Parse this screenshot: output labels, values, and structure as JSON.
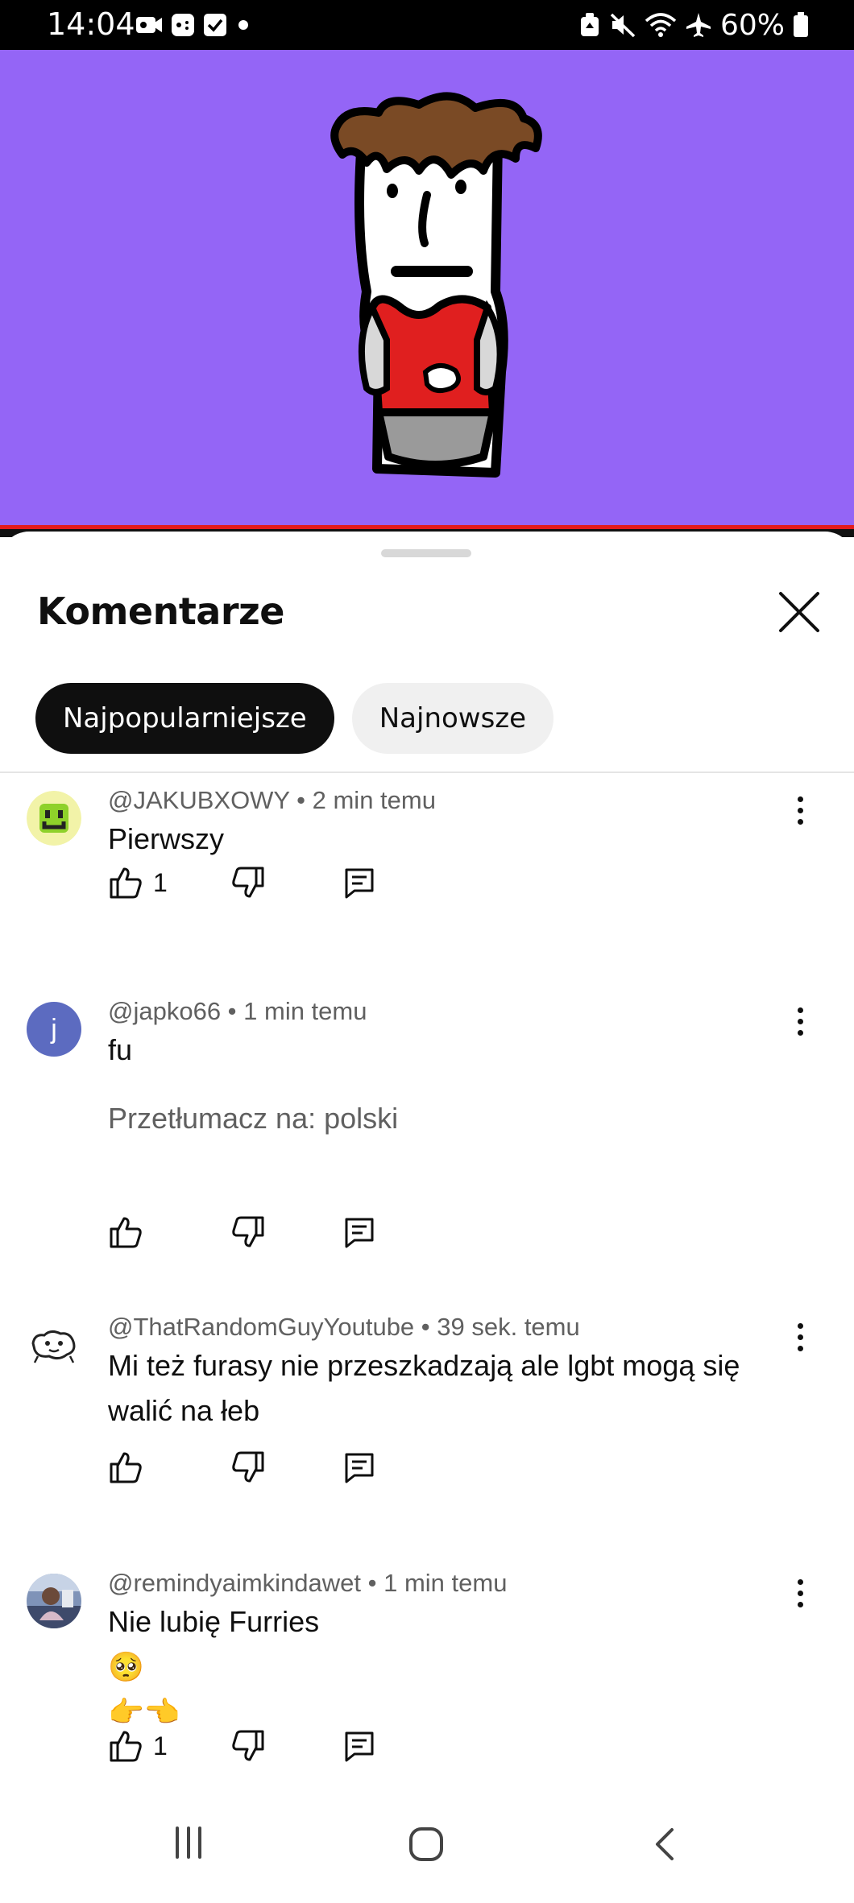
{
  "status_bar": {
    "time": "14:04",
    "battery": "60%",
    "left_icons": [
      "video-camera-icon",
      "game-controller-icon",
      "checkbox-icon",
      "dot-icon"
    ],
    "right_icons": [
      "recycle-icon",
      "mute-icon",
      "wifi-icon",
      "airplane-icon",
      "battery-icon"
    ]
  },
  "video": {
    "background": "#9465f6",
    "progress_color": "#e31b1b"
  },
  "comments_panel": {
    "title": "Komentarze",
    "filters": [
      {
        "label": "Najpopularniejsze",
        "selected": true
      },
      {
        "label": "Najnowsze",
        "selected": false
      }
    ],
    "comments": [
      {
        "author": "@JAKUBXOWY",
        "time": "2 min temu",
        "meta": "@JAKUBXOWY • 2 min temu",
        "lines": [
          "Pierwszy"
        ],
        "likes": "1",
        "avatar": "green-smiley-avatar"
      },
      {
        "author": "@japko66",
        "time": "1 min temu",
        "meta": "@japko66 • 1 min temu",
        "lines": [
          "fu"
        ],
        "translate": "Przetłumacz na: polski",
        "likes": "",
        "avatar_letter": "j",
        "avatar_color": "#5c6bc0"
      },
      {
        "author": "@ThatRandomGuyYoutube",
        "time": "39 sek. temu",
        "meta": "@ThatRandomGuyYoutube • 39 sek. temu",
        "lines": [
          "Mi też furasy nie przeszkadzają ale lgbt mogą się",
          "walić na łeb"
        ],
        "likes": "",
        "avatar": "doodle-face-avatar"
      },
      {
        "author": "@remindyaimkindawet",
        "time": "1 min temu",
        "meta": "@remindyaimkindawet • 1 min temu",
        "lines": [
          "Nie lubię Furries",
          "🥺",
          "👉👈"
        ],
        "likes": "1",
        "avatar": "photo-avatar"
      }
    ]
  },
  "nav_bar": {
    "buttons": [
      "recents-icon",
      "home-icon",
      "back-icon"
    ]
  }
}
